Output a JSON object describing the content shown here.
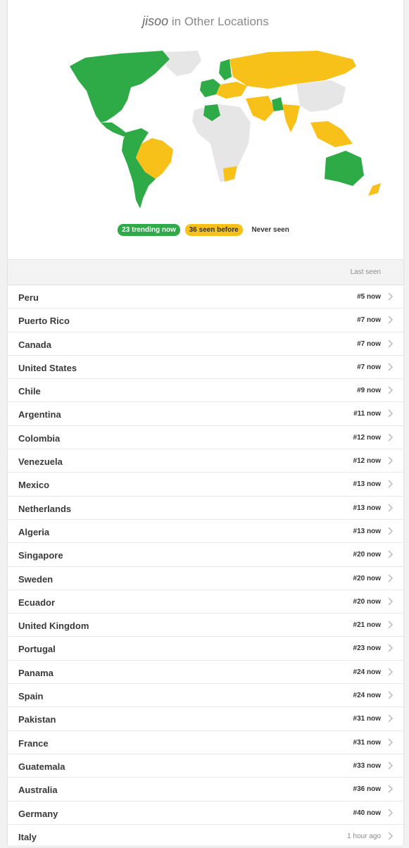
{
  "header": {
    "name": "jisoo",
    "suffix": " in Other Locations"
  },
  "legend": {
    "trending": "23 trending now",
    "seen": "36 seen before",
    "never": "Never seen"
  },
  "colors": {
    "trending": "#2eaa46",
    "seen": "#f8c11a",
    "never": "#e6e6e6"
  },
  "list": {
    "column_header": "Last seen",
    "rows": [
      {
        "country": "Peru",
        "rank": "#5 now"
      },
      {
        "country": "Puerto Rico",
        "rank": "#7 now"
      },
      {
        "country": "Canada",
        "rank": "#7 now"
      },
      {
        "country": "United States",
        "rank": "#7 now"
      },
      {
        "country": "Chile",
        "rank": "#9 now"
      },
      {
        "country": "Argentina",
        "rank": "#11 now"
      },
      {
        "country": "Colombia",
        "rank": "#12 now"
      },
      {
        "country": "Venezuela",
        "rank": "#12 now"
      },
      {
        "country": "Mexico",
        "rank": "#13 now"
      },
      {
        "country": "Netherlands",
        "rank": "#13 now"
      },
      {
        "country": "Algeria",
        "rank": "#13 now"
      },
      {
        "country": "Singapore",
        "rank": "#20 now"
      },
      {
        "country": "Sweden",
        "rank": "#20 now"
      },
      {
        "country": "Ecuador",
        "rank": "#20 now"
      },
      {
        "country": "United Kingdom",
        "rank": "#21 now"
      },
      {
        "country": "Portugal",
        "rank": "#23 now"
      },
      {
        "country": "Panama",
        "rank": "#24 now"
      },
      {
        "country": "Spain",
        "rank": "#24 now"
      },
      {
        "country": "Pakistan",
        "rank": "#31 now"
      },
      {
        "country": "France",
        "rank": "#31 now"
      },
      {
        "country": "Guatemala",
        "rank": "#33 now"
      },
      {
        "country": "Australia",
        "rank": "#36 now"
      },
      {
        "country": "Germany",
        "rank": "#40 now"
      },
      {
        "country": "Italy",
        "rank": "1 hour ago",
        "muted": true
      }
    ]
  }
}
